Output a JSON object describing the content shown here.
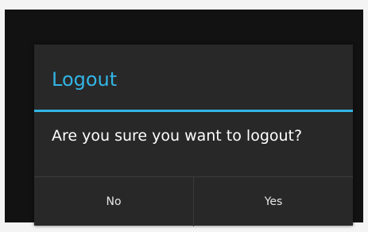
{
  "dialog": {
    "title": "Logout",
    "message": "Are you sure you want to logout?",
    "negative_label": "No",
    "positive_label": "Yes",
    "accent_color": "#33b5e5"
  }
}
